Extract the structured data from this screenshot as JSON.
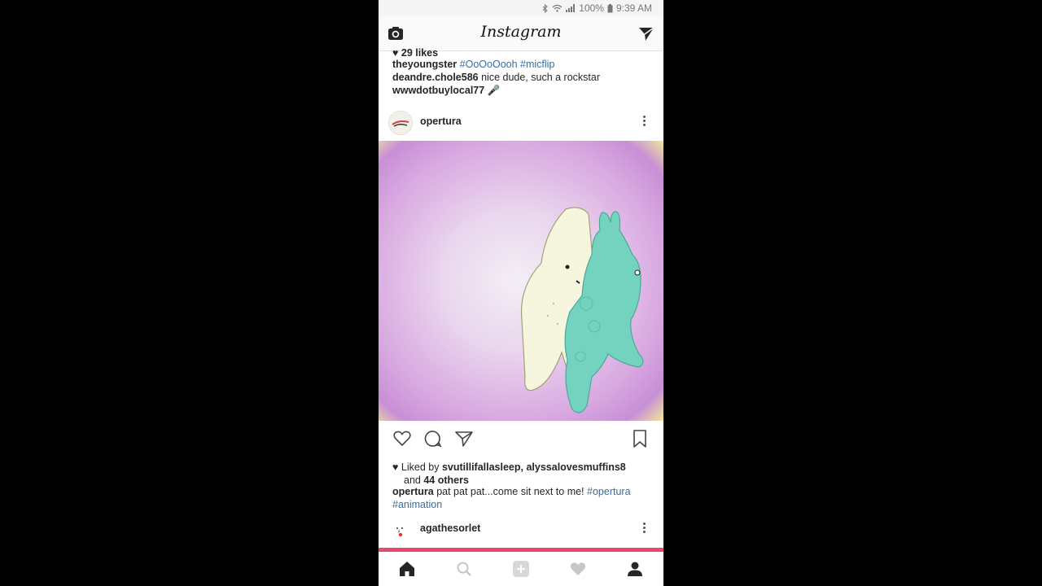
{
  "status": {
    "battery": "100%",
    "time": "9:39 AM"
  },
  "header": {
    "logo": "Instagram",
    "camera_icon": "camera-icon",
    "direct_icon": "paper-plane-icon"
  },
  "prev_post": {
    "likes": "29 likes",
    "caption_user": "theyoungster",
    "caption_tags": "#OoOoOooh #micflip",
    "comments": [
      {
        "user": "deandre.chole586",
        "text": "nice dude, such a rockstar"
      },
      {
        "user": "wwwdotbuylocal77",
        "text": "🎤"
      }
    ]
  },
  "post": {
    "username": "opertura",
    "liked_by_prefix": "Liked by",
    "liked_by_users": "svutillifallasleep, alyssalovesmuffins8",
    "and_text": "and",
    "others": "44 others",
    "caption_user": "opertura",
    "caption_text": "pat pat pat...come sit next to me!",
    "caption_tag1": "#opertura",
    "caption_tag2": "#animation"
  },
  "next_post": {
    "username": "agathesorlet"
  },
  "nav": {
    "items": [
      "home-icon",
      "search-icon",
      "add-icon",
      "heart-icon",
      "profile-icon"
    ]
  },
  "colors": {
    "accent": "#e94a6b",
    "link": "#3b6c9d"
  }
}
